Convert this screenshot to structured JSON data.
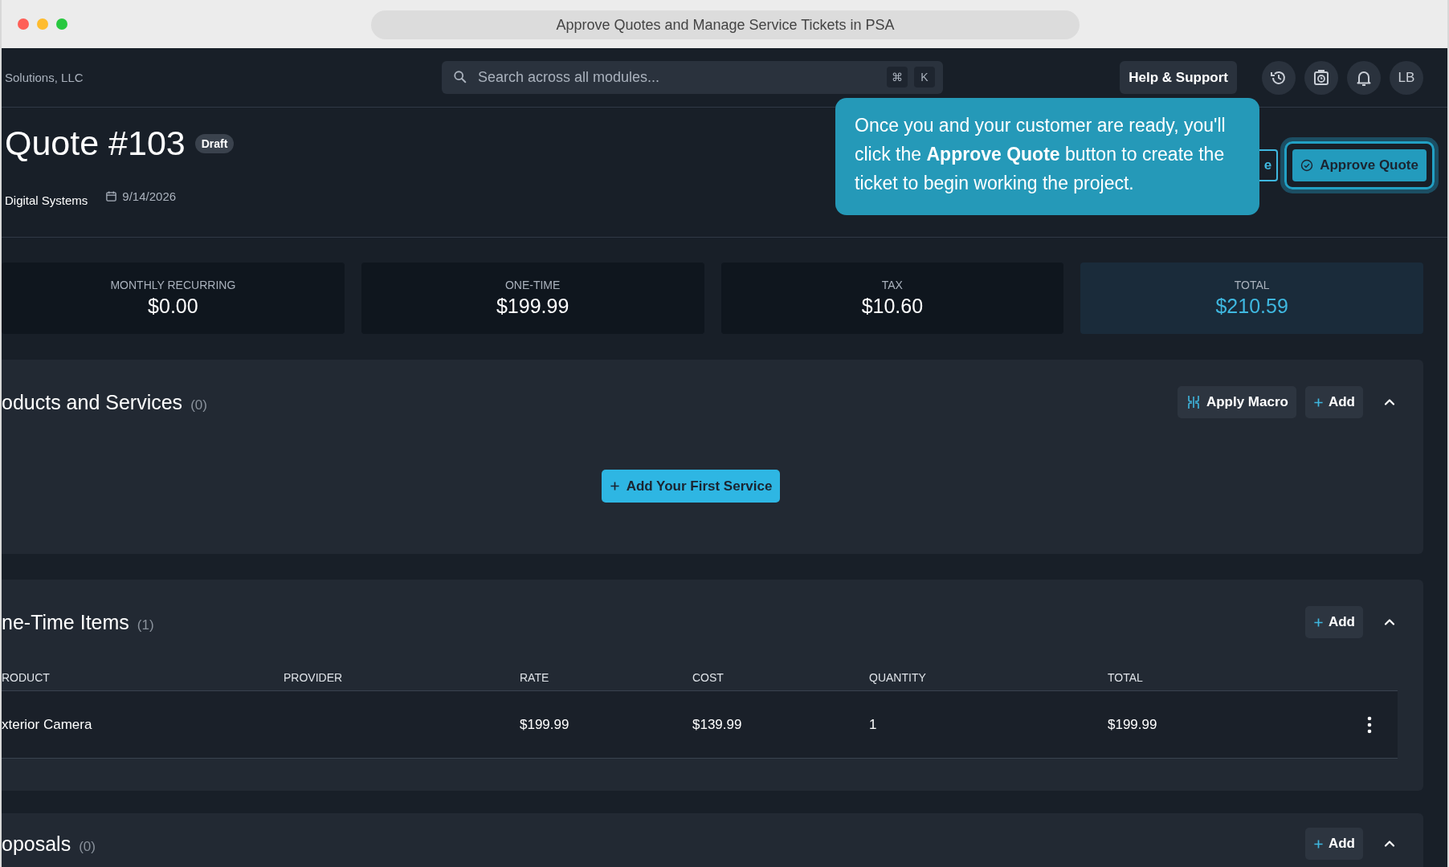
{
  "window": {
    "title": "Approve Quotes and Manage Service Tickets in PSA"
  },
  "topbar": {
    "organization": "Solutions, LLC",
    "search": {
      "placeholder": "Search across all modules...",
      "keys": [
        "⌘",
        "K"
      ]
    },
    "help_button": "Help & Support",
    "avatar": "LB"
  },
  "quote": {
    "title": "Quote #103",
    "status": "Draft",
    "customer": "Digital Systems",
    "date": "9/14/2026"
  },
  "actions": {
    "partial_button": "e",
    "approve_button": "Approve Quote"
  },
  "tooltip": {
    "text": "Once you and your customer are ready, you'll click the **Approve Quote** button to create the ticket to begin working the project."
  },
  "summary": [
    {
      "label": "MONTHLY RECURRING",
      "value": "$0.00",
      "highlighted": false
    },
    {
      "label": "ONE-TIME",
      "value": "$199.99",
      "highlighted": false
    },
    {
      "label": "TAX",
      "value": "$10.60",
      "highlighted": false
    },
    {
      "label": "TOTAL",
      "value": "$210.59",
      "highlighted": true
    }
  ],
  "products": {
    "title": "oducts and Services",
    "count": "(0)",
    "macro_button": "Apply Macro",
    "add_button": "Add",
    "empty_button": "Add Your First Service"
  },
  "one_time": {
    "title": "ne-Time Items",
    "count": "(1)",
    "add_button": "Add",
    "columns": [
      "RODUCT",
      "PROVIDER",
      "RATE",
      "COST",
      "QUANTITY",
      "TOTAL"
    ],
    "rows": [
      [
        "xterior Camera",
        "",
        "$199.99",
        "$139.99",
        "1",
        "$199.99"
      ]
    ]
  },
  "proposals": {
    "title": "oposals",
    "count": "(0)",
    "add_button": "Add"
  }
}
